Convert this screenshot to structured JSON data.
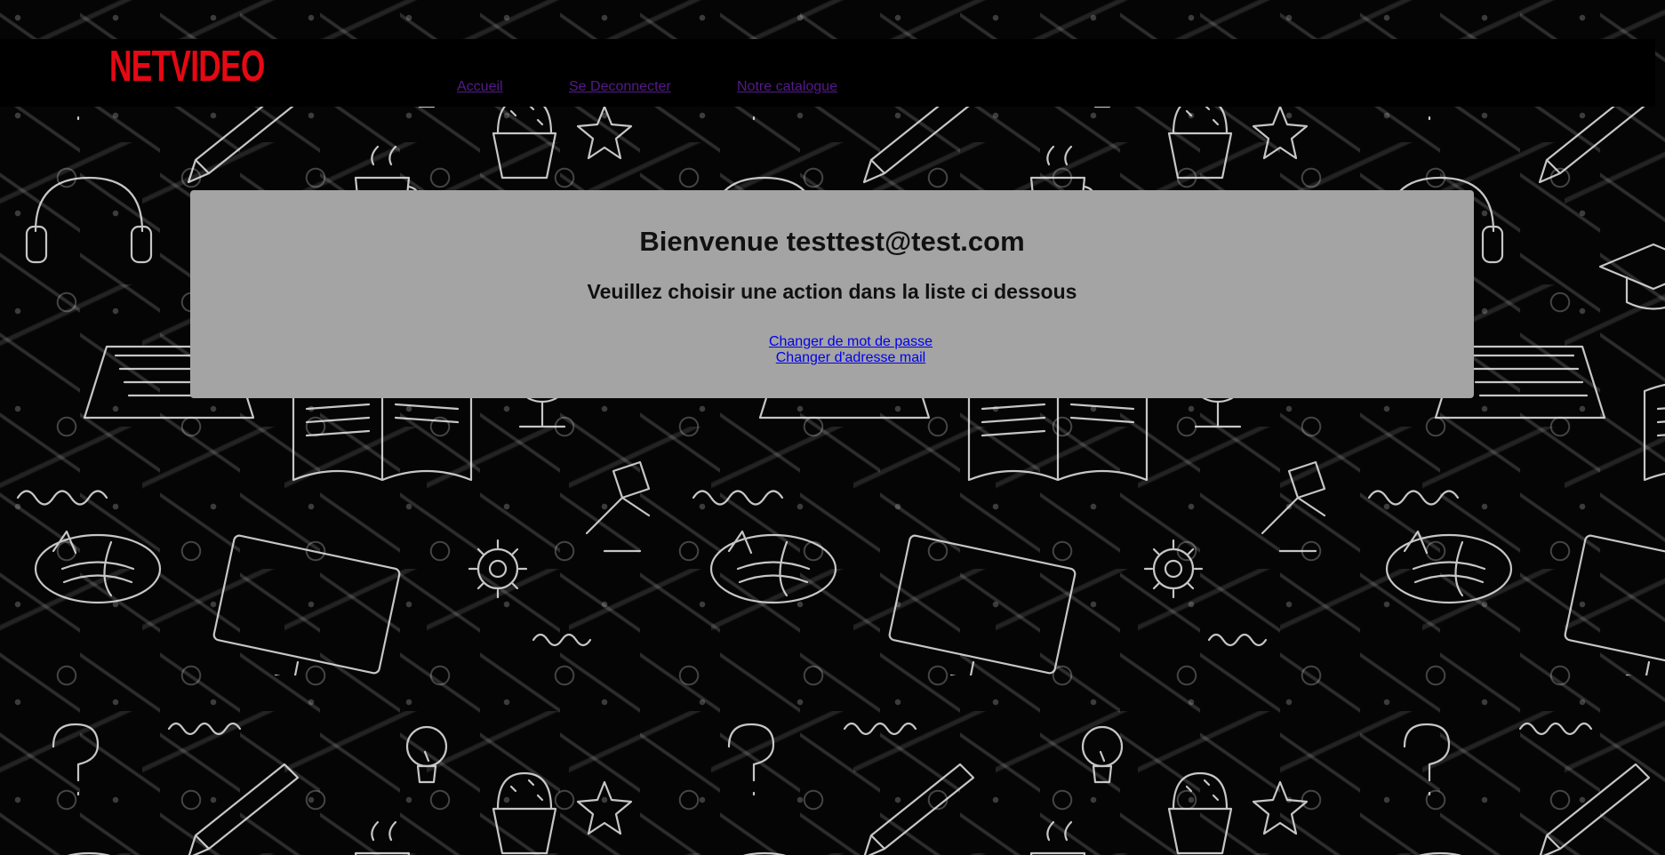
{
  "brand": {
    "logo_text": "NETVIDEO",
    "logo_color": "#e50914"
  },
  "nav": [
    {
      "label": "Accueil"
    },
    {
      "label": "Se Deconnecter"
    },
    {
      "label": "Notre catalogue"
    }
  ],
  "welcome": {
    "title": "Bienvenue testtest@test.com",
    "subtitle": "Veuillez choisir une action dans la liste ci dessous"
  },
  "actions": [
    {
      "label": "Changer de mot de passe"
    },
    {
      "label": "Changer d'adresse mail"
    }
  ],
  "colors": {
    "page_background": "#050505",
    "header_background": "#000000",
    "panel_background": "#a4a4a4",
    "visited_link": "#551a8b",
    "link": "#0000ee"
  }
}
